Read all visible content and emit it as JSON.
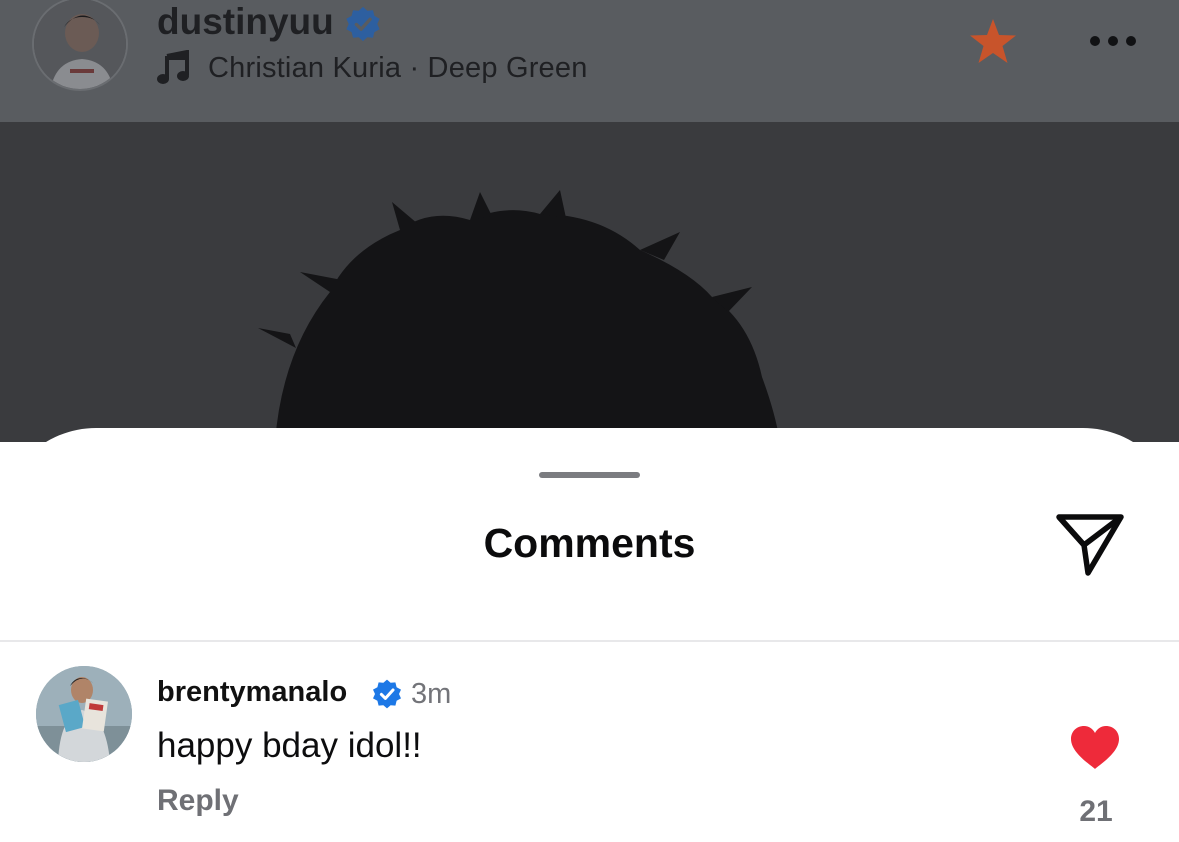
{
  "post": {
    "username": "dustinyuu",
    "verified": true,
    "song": "Christian Kuria · Deep Green"
  },
  "sheet": {
    "title": "Comments"
  },
  "comments": [
    {
      "username": "brentymanalo",
      "verified": true,
      "time": "3m",
      "text": "happy bday idol!!",
      "reply_label": "Reply",
      "likes": "21"
    }
  ],
  "icons": {
    "verified": "verified-badge-icon",
    "music": "music-note-icon",
    "favorite": "star-icon",
    "more": "more-options-icon",
    "share": "send-icon",
    "like": "heart-icon"
  },
  "colors": {
    "verified_blue": "#1d78e6",
    "heart_red": "#ee2a3a",
    "star_orange": "#c8542b"
  }
}
